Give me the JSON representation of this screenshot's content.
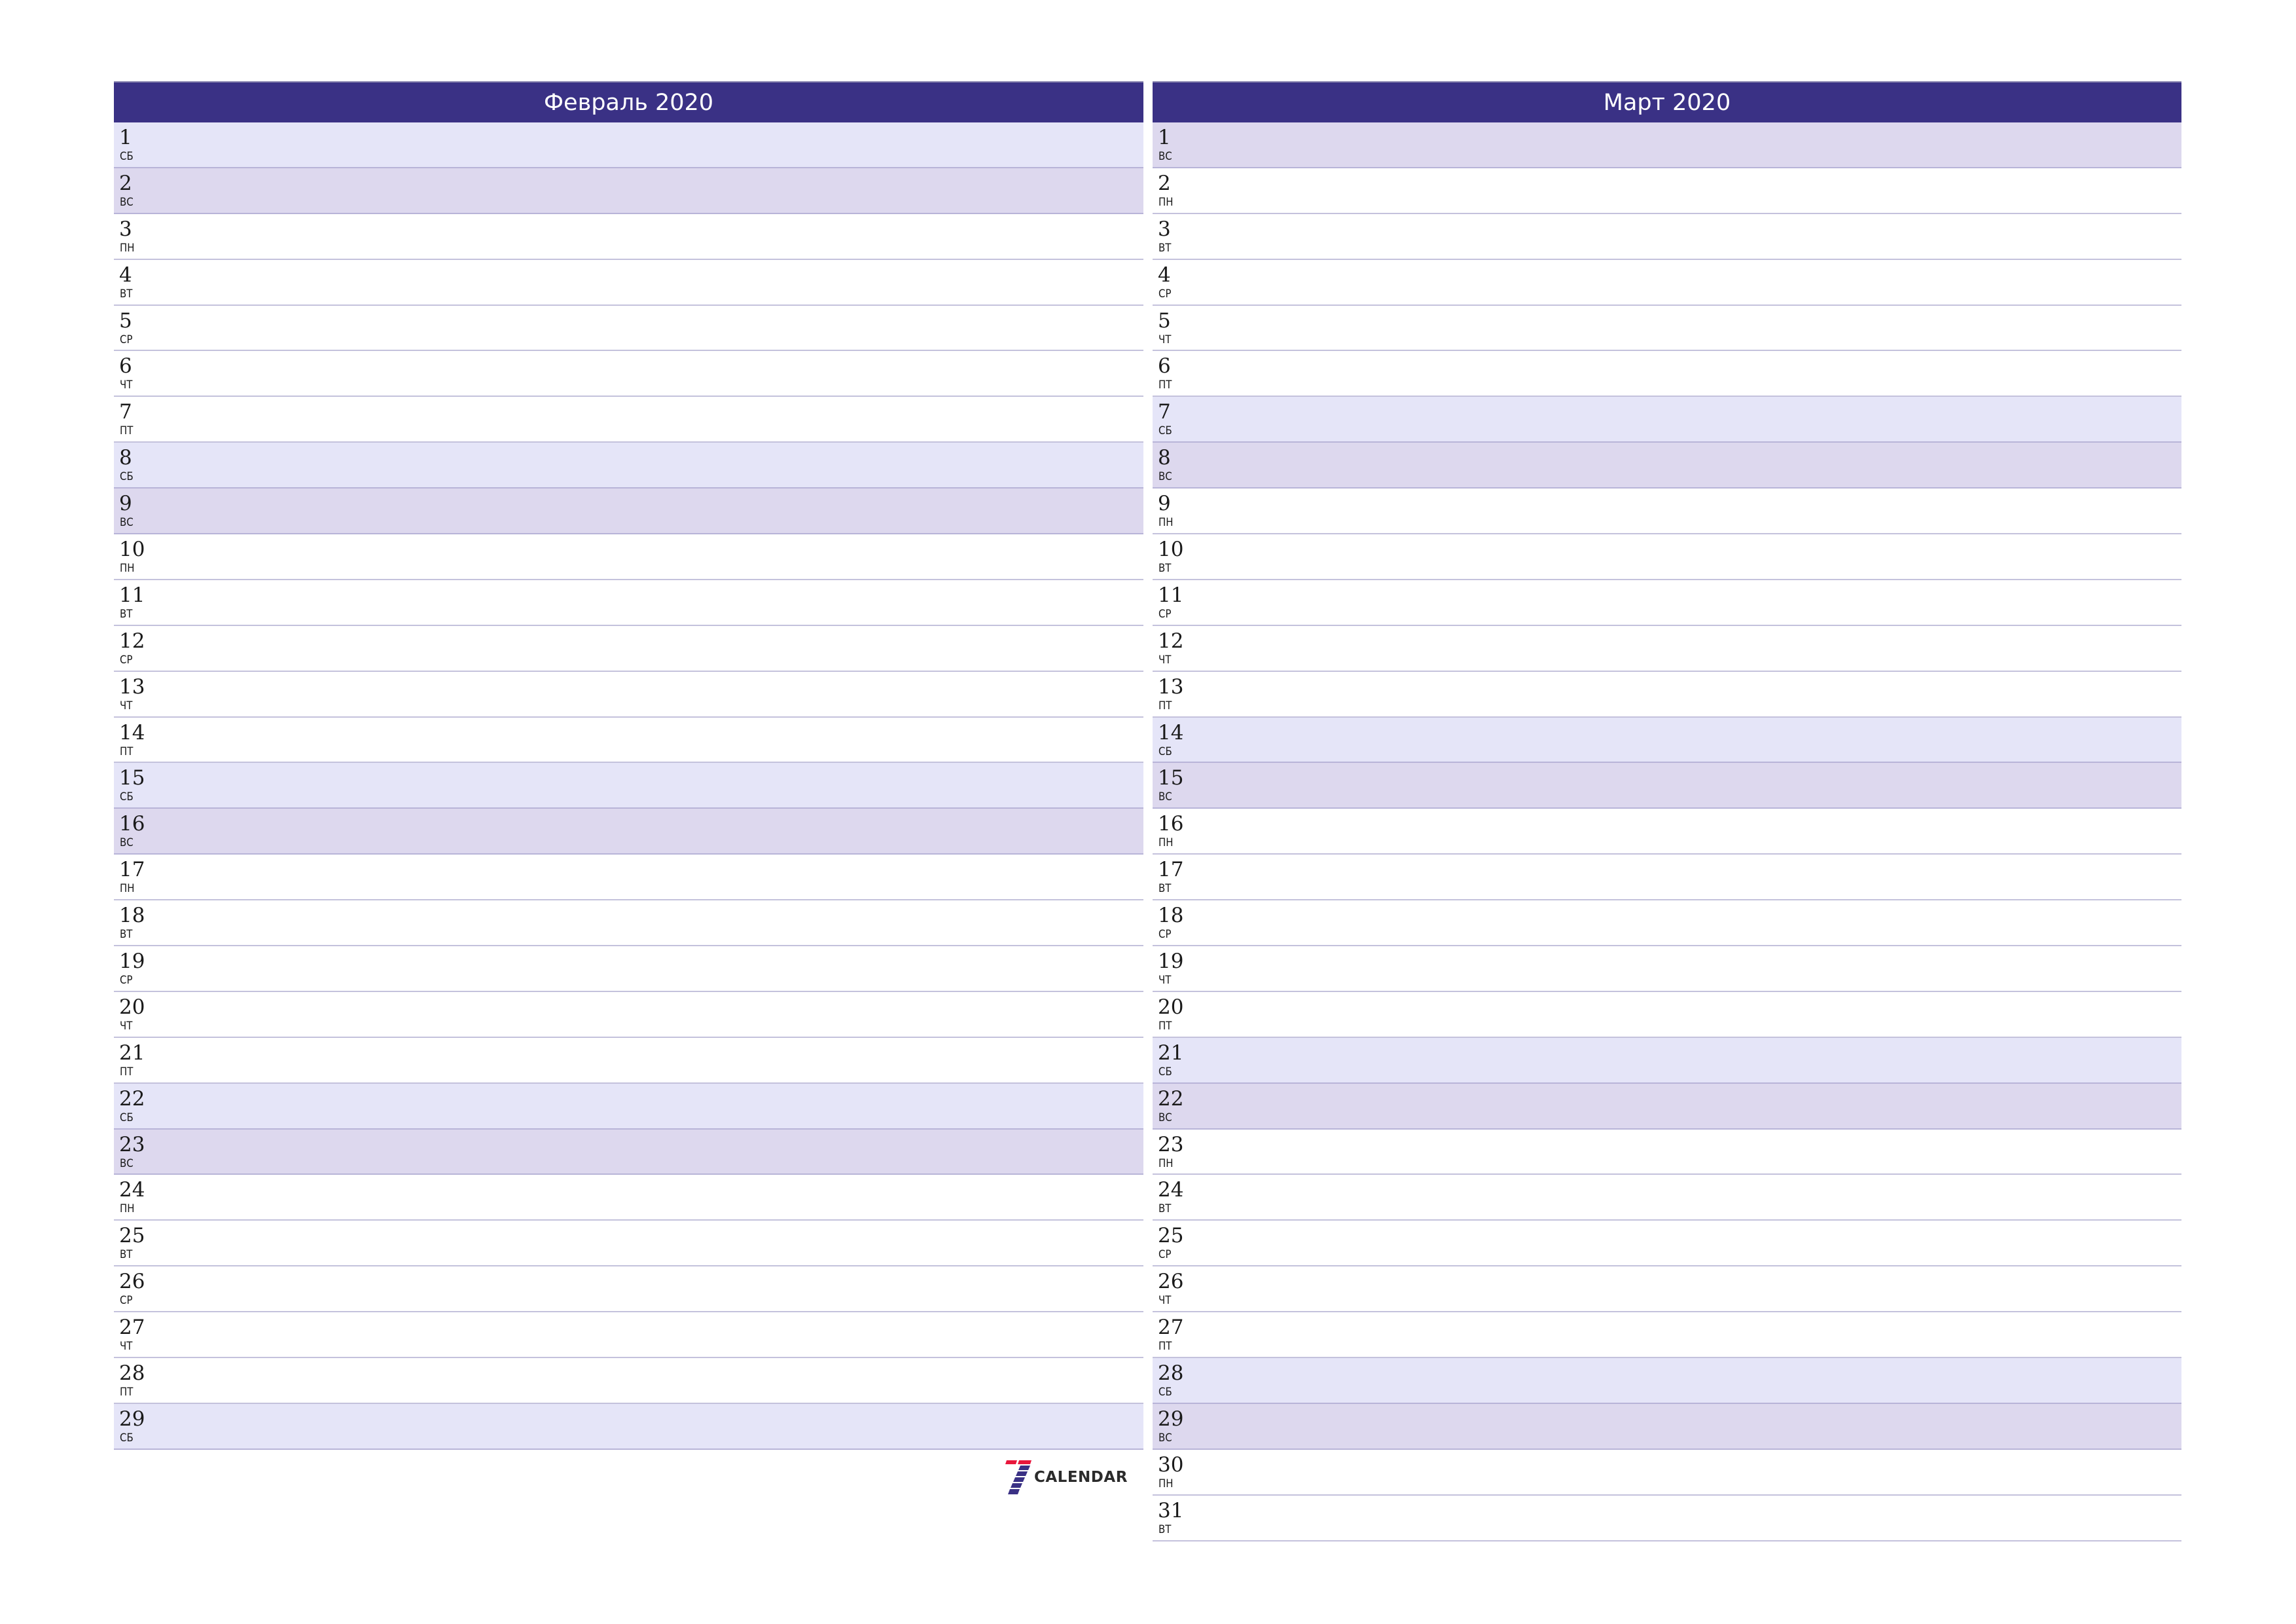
{
  "months": [
    {
      "title": "Февраль 2020",
      "days": [
        {
          "n": "1",
          "wd": "СБ",
          "type": "sat"
        },
        {
          "n": "2",
          "wd": "ВС",
          "type": "sun"
        },
        {
          "n": "3",
          "wd": "ПН",
          "type": ""
        },
        {
          "n": "4",
          "wd": "ВТ",
          "type": ""
        },
        {
          "n": "5",
          "wd": "СР",
          "type": ""
        },
        {
          "n": "6",
          "wd": "ЧТ",
          "type": ""
        },
        {
          "n": "7",
          "wd": "ПТ",
          "type": ""
        },
        {
          "n": "8",
          "wd": "СБ",
          "type": "sat"
        },
        {
          "n": "9",
          "wd": "ВС",
          "type": "sun"
        },
        {
          "n": "10",
          "wd": "ПН",
          "type": ""
        },
        {
          "n": "11",
          "wd": "ВТ",
          "type": ""
        },
        {
          "n": "12",
          "wd": "СР",
          "type": ""
        },
        {
          "n": "13",
          "wd": "ЧТ",
          "type": ""
        },
        {
          "n": "14",
          "wd": "ПТ",
          "type": ""
        },
        {
          "n": "15",
          "wd": "СБ",
          "type": "sat"
        },
        {
          "n": "16",
          "wd": "ВС",
          "type": "sun"
        },
        {
          "n": "17",
          "wd": "ПН",
          "type": ""
        },
        {
          "n": "18",
          "wd": "ВТ",
          "type": ""
        },
        {
          "n": "19",
          "wd": "СР",
          "type": ""
        },
        {
          "n": "20",
          "wd": "ЧТ",
          "type": ""
        },
        {
          "n": "21",
          "wd": "ПТ",
          "type": ""
        },
        {
          "n": "22",
          "wd": "СБ",
          "type": "sat"
        },
        {
          "n": "23",
          "wd": "ВС",
          "type": "sun"
        },
        {
          "n": "24",
          "wd": "ПН",
          "type": ""
        },
        {
          "n": "25",
          "wd": "ВТ",
          "type": ""
        },
        {
          "n": "26",
          "wd": "СР",
          "type": ""
        },
        {
          "n": "27",
          "wd": "ЧТ",
          "type": ""
        },
        {
          "n": "28",
          "wd": "ПТ",
          "type": ""
        },
        {
          "n": "29",
          "wd": "СБ",
          "type": "sat"
        }
      ]
    },
    {
      "title": "Март 2020",
      "days": [
        {
          "n": "1",
          "wd": "ВС",
          "type": "sun"
        },
        {
          "n": "2",
          "wd": "ПН",
          "type": ""
        },
        {
          "n": "3",
          "wd": "ВТ",
          "type": ""
        },
        {
          "n": "4",
          "wd": "СР",
          "type": ""
        },
        {
          "n": "5",
          "wd": "ЧТ",
          "type": ""
        },
        {
          "n": "6",
          "wd": "ПТ",
          "type": ""
        },
        {
          "n": "7",
          "wd": "СБ",
          "type": "sat"
        },
        {
          "n": "8",
          "wd": "ВС",
          "type": "sun"
        },
        {
          "n": "9",
          "wd": "ПН",
          "type": ""
        },
        {
          "n": "10",
          "wd": "ВТ",
          "type": ""
        },
        {
          "n": "11",
          "wd": "СР",
          "type": ""
        },
        {
          "n": "12",
          "wd": "ЧТ",
          "type": ""
        },
        {
          "n": "13",
          "wd": "ПТ",
          "type": ""
        },
        {
          "n": "14",
          "wd": "СБ",
          "type": "sat"
        },
        {
          "n": "15",
          "wd": "ВС",
          "type": "sun"
        },
        {
          "n": "16",
          "wd": "ПН",
          "type": ""
        },
        {
          "n": "17",
          "wd": "ВТ",
          "type": ""
        },
        {
          "n": "18",
          "wd": "СР",
          "type": ""
        },
        {
          "n": "19",
          "wd": "ЧТ",
          "type": ""
        },
        {
          "n": "20",
          "wd": "ПТ",
          "type": ""
        },
        {
          "n": "21",
          "wd": "СБ",
          "type": "sat"
        },
        {
          "n": "22",
          "wd": "ВС",
          "type": "sun"
        },
        {
          "n": "23",
          "wd": "ПН",
          "type": ""
        },
        {
          "n": "24",
          "wd": "ВТ",
          "type": ""
        },
        {
          "n": "25",
          "wd": "СР",
          "type": ""
        },
        {
          "n": "26",
          "wd": "ЧТ",
          "type": ""
        },
        {
          "n": "27",
          "wd": "ПТ",
          "type": ""
        },
        {
          "n": "28",
          "wd": "СБ",
          "type": "sat"
        },
        {
          "n": "29",
          "wd": "ВС",
          "type": "sun"
        },
        {
          "n": "30",
          "wd": "ПН",
          "type": ""
        },
        {
          "n": "31",
          "wd": "ВТ",
          "type": ""
        }
      ]
    }
  ],
  "logo": {
    "icon": "seven-logo-icon",
    "text": "CALENDAR"
  },
  "colors": {
    "header": "#3a3185",
    "saturday": "#e5e5f8",
    "sunday": "#ddd8ee",
    "separator": "#c4c2dc",
    "logo_red": "#e8173c",
    "logo_blue": "#3a3185"
  }
}
